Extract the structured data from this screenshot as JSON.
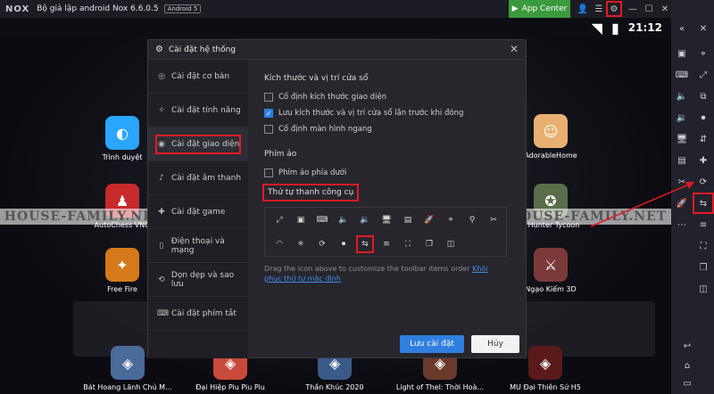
{
  "titlebar": {
    "logo": "NOX",
    "title": "Bộ giả lập android Nox 6.6.0.5",
    "android_badge": "Android 5",
    "app_center": "App Center"
  },
  "statusbar": {
    "clock": "21:12"
  },
  "desktop": {
    "apps": [
      {
        "label": "Trình duyệt",
        "icon": "browser-icon",
        "color": "#2aa6ff"
      },
      {
        "label": "AutoChess VNG",
        "icon": "autochess-icon",
        "color": "#c72a2a"
      },
      {
        "label": "Free Fire",
        "icon": "freefire-icon",
        "color": "#d47a1a"
      },
      {
        "label": "AdorableHome",
        "icon": "adorablehome-icon",
        "color": "#e8b070"
      },
      {
        "label": "il Hunter Tycoon",
        "icon": "hunter-icon",
        "color": "#5a6e4a"
      },
      {
        "label": "Ngạo Kiếm 3D",
        "icon": "ngaokiem-icon",
        "color": "#7a3a3a"
      }
    ],
    "dock": [
      {
        "label": "Bát Hoang Lãnh Chủ M...",
        "color": "#4a6a9a"
      },
      {
        "label": "Đại Hiệp Piu Piu Piu",
        "color": "#c84a3a"
      },
      {
        "label": "Thần Khúc 2020",
        "color": "#3a5a8a"
      },
      {
        "label": "Light of Thel: Thời Hoà...",
        "color": "#6a3a2a"
      },
      {
        "label": "MU Đại Thiên Sứ H5",
        "color": "#5a1a1a"
      }
    ]
  },
  "watermark": "HOUSE-FAMILY.NET",
  "dialog": {
    "title": "Cài đặt hệ thống",
    "nav": [
      {
        "label": "Cài đặt cơ bản",
        "icon": "basic-settings-icon"
      },
      {
        "label": "Cài đặt tính năng",
        "icon": "feature-settings-icon"
      },
      {
        "label": "Cài đặt giao diện",
        "icon": "interface-settings-icon"
      },
      {
        "label": "Cài đặt âm thanh",
        "icon": "sound-settings-icon"
      },
      {
        "label": "Cài đặt game",
        "icon": "game-settings-icon"
      },
      {
        "label": "Điện thoại và mạng",
        "icon": "phone-network-icon"
      },
      {
        "label": "Dọn dẹp và sao lưu",
        "icon": "cleanup-backup-icon"
      },
      {
        "label": "Cài đặt phím tắt",
        "icon": "shortcut-settings-icon"
      }
    ],
    "active_nav_index": 2,
    "window_section": "Kích thước và vị trí cửa sổ",
    "options": [
      {
        "label": "Cố định kích thước giao diện",
        "checked": false
      },
      {
        "label": "Lưu kích thước và vị trí cửa sổ lần trước khi đóng",
        "checked": true
      },
      {
        "label": "Cố định màn hình ngang",
        "checked": false
      }
    ],
    "virtual_keys_section": "Phím ảo",
    "virtual_keys_option": {
      "label": "Phím ảo phía dưới",
      "checked": false
    },
    "toolbar_order_title": "Thứ tự thanh công cụ",
    "hint_text": "Drag the icon above to customize the toolbar items order ",
    "hint_link": "Khôi phục thứ tự mặc định",
    "save_label": "Lưu cài đặt",
    "cancel_label": "Hủy"
  }
}
